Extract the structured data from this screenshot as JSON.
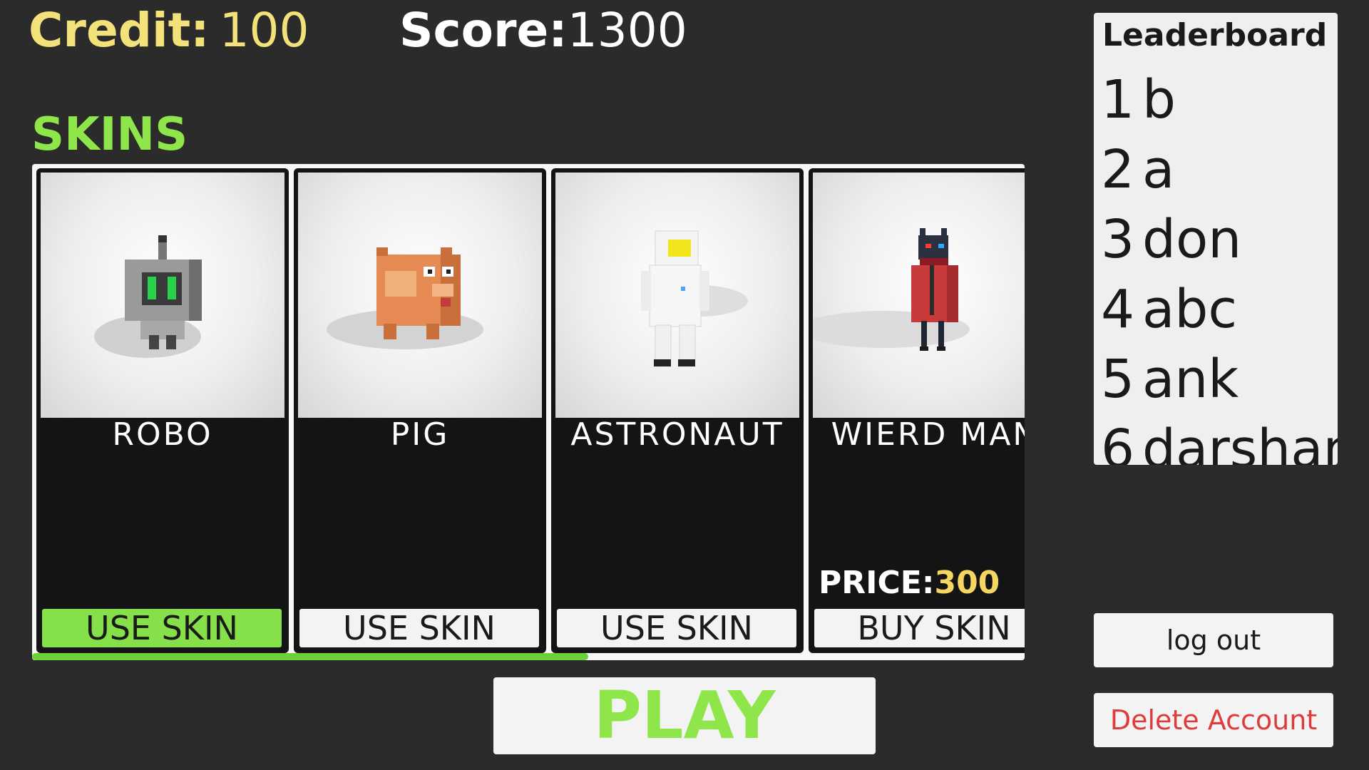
{
  "hud": {
    "credit_label": "Credit:",
    "credit_value": "100",
    "score_label": "Score:",
    "score_value": "1300"
  },
  "skins_section": {
    "title": "SKINS",
    "scroll_position": 0.56,
    "items": [
      {
        "name": "ROBO",
        "button": "USE SKIN",
        "active": true
      },
      {
        "name": "PIG",
        "button": "USE SKIN",
        "active": false
      },
      {
        "name": "ASTRONAUT",
        "button": "USE SKIN",
        "active": false
      },
      {
        "name": "WIERD MAN",
        "price_label": "PRICE:",
        "price_value": "300",
        "button": "BUY SKIN",
        "active": false
      }
    ]
  },
  "leaderboard": {
    "title": "Leaderboard",
    "entries": [
      {
        "rank": "1",
        "name": "b"
      },
      {
        "rank": "2",
        "name": "a"
      },
      {
        "rank": "3",
        "name": "don"
      },
      {
        "rank": "4",
        "name": "abc"
      },
      {
        "rank": "5",
        "name": "ank"
      },
      {
        "rank": "6",
        "name": "darshan"
      }
    ]
  },
  "account": {
    "logout_label": "log out",
    "delete_label": "Delete Account"
  },
  "play_label": "PLAY",
  "colors": {
    "background": "#2b2b2b",
    "credit": "#f3e27a",
    "accent_green": "#8fe64b",
    "price": "#f3d760",
    "delete": "#e03b3b"
  }
}
